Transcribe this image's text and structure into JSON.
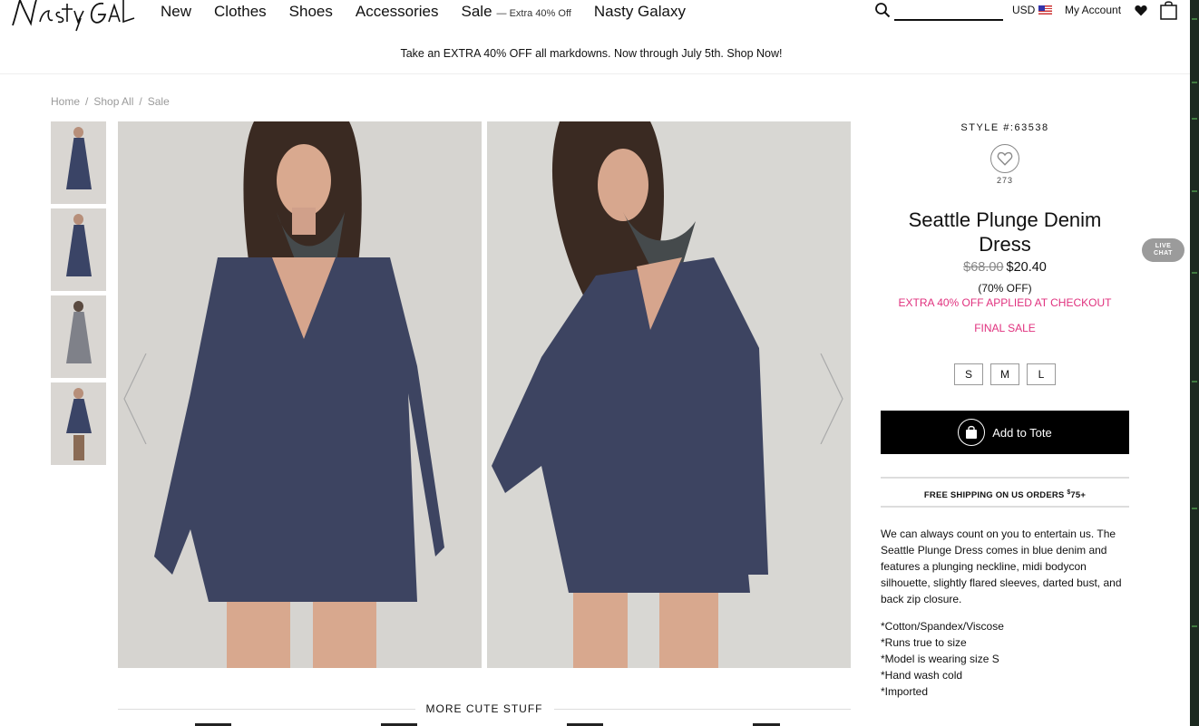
{
  "brand": {
    "logo_text": "Nasty Gal"
  },
  "nav": {
    "items": [
      {
        "label": "New"
      },
      {
        "label": "Clothes"
      },
      {
        "label": "Shoes"
      },
      {
        "label": "Accessories"
      },
      {
        "label": "Sale",
        "note": "— Extra 40% Off"
      },
      {
        "label": "Nasty Galaxy"
      }
    ]
  },
  "utility": {
    "currency": "USD",
    "account": "My Account",
    "icons": [
      "search-icon",
      "us-flag-icon",
      "heart-icon",
      "bag-icon"
    ]
  },
  "promo": {
    "text": "Take an EXTRA 40% OFF all markdowns. Now through July 5th. Shop Now!"
  },
  "breadcrumb": {
    "items": [
      "Home",
      "Shop All",
      "Sale"
    ],
    "separator": "/"
  },
  "product": {
    "style": "STYLE #:63538",
    "favorites": "273",
    "title": "Seattle Plunge Denim Dress",
    "old_price": "$68.00",
    "new_price": "$20.40",
    "discount": "(70% OFF)",
    "extra_note": "EXTRA 40% OFF APPLIED AT CHECKOUT",
    "final_sale": "FINAL SALE",
    "sizes": [
      "S",
      "M",
      "L"
    ],
    "add_to_tote": "Add to Tote",
    "shipping": {
      "text": "FREE SHIPPING ON US ORDERS ",
      "sup": "$",
      "amount": "75+"
    },
    "description": "We can always count on you to entertain us. The Seattle Plunge Dress comes in blue denim and features a plunging neckline, midi bodycon silhouette, slightly flared sleeves, darted bust, and back zip closure.",
    "features": [
      "*Cotton/Spandex/Viscose",
      "*Runs true to size",
      "*Model is wearing size S",
      "*Hand wash cold",
      "*Imported"
    ]
  },
  "live_chat": {
    "line1": "LIVE",
    "line2": "CHAT"
  },
  "more": {
    "label": "MORE CUTE STUFF"
  },
  "colors": {
    "accent_pink": "#e0317e",
    "black": "#000000",
    "denim": "#3a4466"
  }
}
